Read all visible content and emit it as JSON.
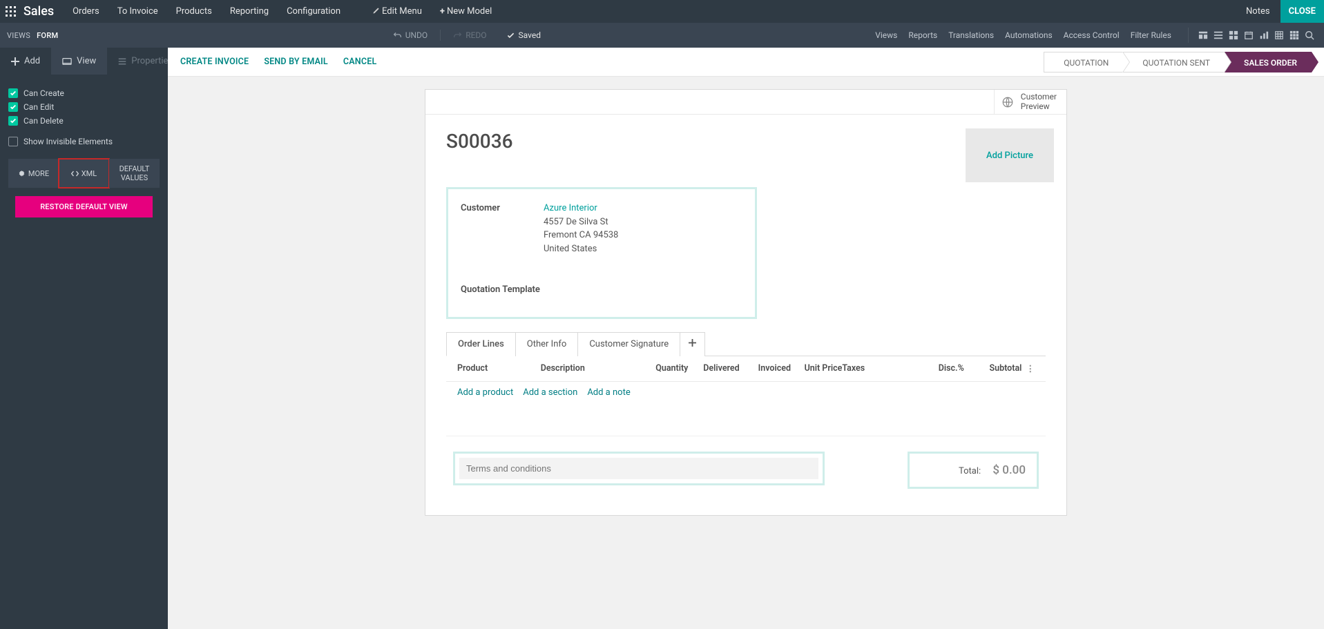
{
  "topbar": {
    "brand": "Sales",
    "menu": [
      "Orders",
      "To Invoice",
      "Products",
      "Reporting",
      "Configuration"
    ],
    "edit_menu": "Edit Menu",
    "new_model": "New Model",
    "notes": "Notes",
    "close": "CLOSE"
  },
  "secondbar": {
    "breadcrumb_left": "VIEWS",
    "breadcrumb_right": "FORM",
    "undo": "UNDO",
    "redo": "REDO",
    "saved": "Saved",
    "links": [
      "Views",
      "Reports",
      "Translations",
      "Automations",
      "Access Control",
      "Filter Rules"
    ]
  },
  "left": {
    "tab_add": "Add",
    "tab_view": "View",
    "tab_props": "Properties",
    "can_create": "Can Create",
    "can_edit": "Can Edit",
    "can_delete": "Can Delete",
    "show_invisible": "Show Invisible Elements",
    "more": "MORE",
    "xml": "XML",
    "default_values": "DEFAULT VALUES",
    "restore": "RESTORE DEFAULT VIEW"
  },
  "actions": {
    "create_invoice": "CREATE INVOICE",
    "send_email": "SEND BY EMAIL",
    "cancel": "CANCEL"
  },
  "status": {
    "quotation": "QUOTATION",
    "quotation_sent": "QUOTATION SENT",
    "sales_order": "SALES ORDER"
  },
  "sheet": {
    "customer_preview": "Customer\nPreview",
    "customer_preview_l1": "Customer",
    "customer_preview_l2": "Preview",
    "add_picture": "Add Picture",
    "order_no": "S00036",
    "customer_label": "Customer",
    "customer_name": "Azure Interior",
    "addr1": "4557 De Silva St",
    "addr2": "Fremont CA 94538",
    "addr3": "United States",
    "quotation_template": "Quotation Template",
    "tabs": {
      "order_lines": "Order Lines",
      "other_info": "Other Info",
      "signature": "Customer Signature"
    },
    "columns": {
      "product": "Product",
      "description": "Description",
      "quantity": "Quantity",
      "delivered": "Delivered",
      "invoiced": "Invoiced",
      "unit_price": "Unit Price",
      "taxes": "Taxes",
      "disc": "Disc.%",
      "subtotal": "Subtotal"
    },
    "add_product": "Add a product",
    "add_section": "Add a section",
    "add_note": "Add a note",
    "terms_placeholder": "Terms and conditions",
    "total_label": "Total:",
    "total_value": "$ 0.00"
  }
}
